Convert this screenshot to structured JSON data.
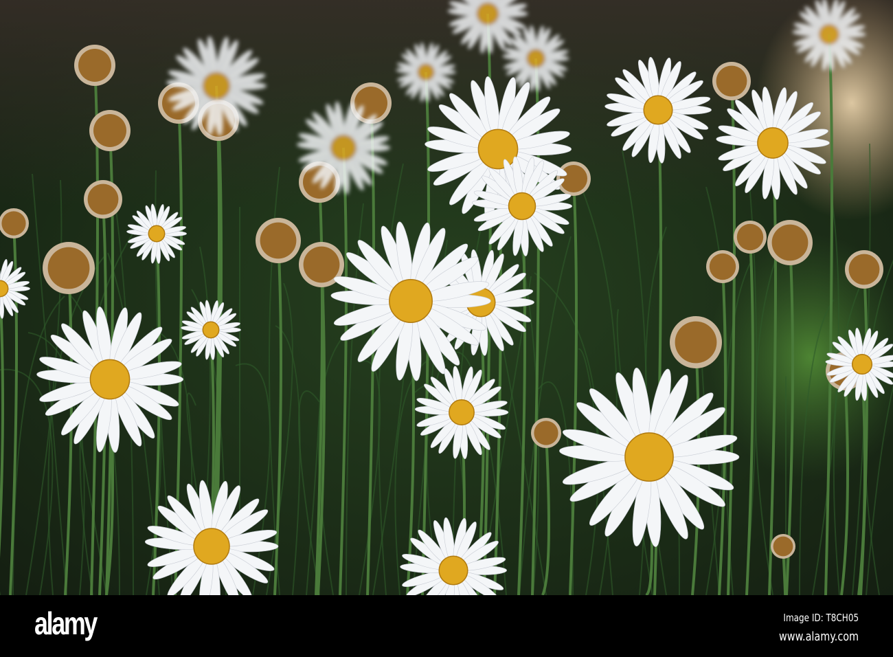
{
  "image": {
    "subject": "daisies",
    "colors": {
      "petal": "#f4f6f8",
      "center": "#e0a820",
      "foliage": "#1c3318",
      "dried": "#9a6a2a"
    }
  },
  "watermark": {
    "logo": "alamy",
    "image_id": "Image ID: T8CH05",
    "url": "www.alamy.com"
  }
}
